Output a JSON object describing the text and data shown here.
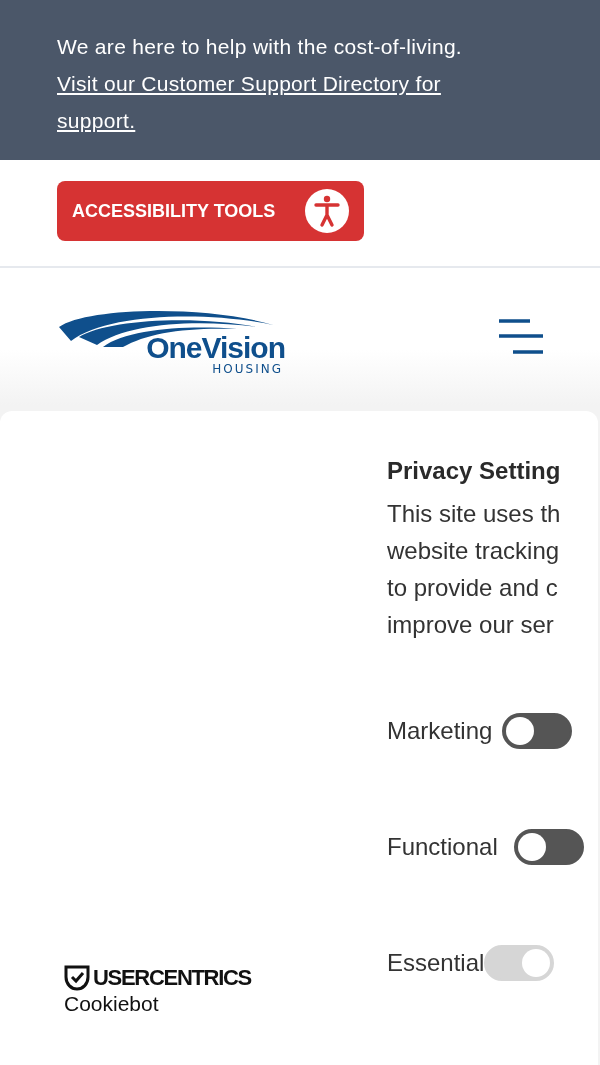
{
  "banner": {
    "text": "We are here to help with the cost-of-living.",
    "link": "Visit our Customer Support Directory for support. "
  },
  "accessibility_button": {
    "label": "ACCESSIBILITY TOOLS"
  },
  "header": {
    "logo": {
      "name": "OneVision",
      "sub": "HOUSING"
    }
  },
  "consent_dialog": {
    "brand": {
      "name": "USERCENTRICS",
      "product": "Cookiebot"
    },
    "title": "Privacy Setting",
    "body_lines": [
      "This site uses th",
      "website tracking",
      "to provide and c",
      "improve our ser"
    ],
    "toggles": [
      {
        "label": "Marketing",
        "on": false,
        "disabled": false
      },
      {
        "label": "Functional",
        "on": false,
        "disabled": false
      },
      {
        "label": "Essential",
        "on": true,
        "disabled": true
      }
    ]
  }
}
